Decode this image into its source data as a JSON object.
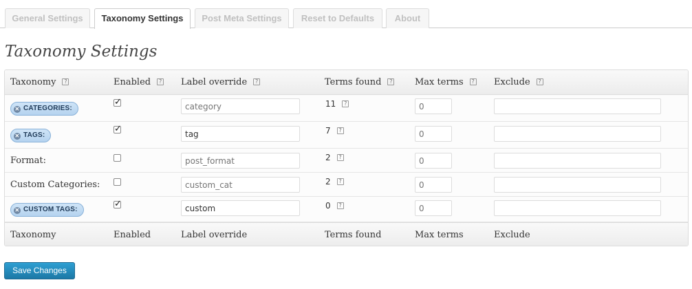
{
  "tabs": [
    {
      "label": "General Settings"
    },
    {
      "label": "Taxonomy Settings"
    },
    {
      "label": "Post Meta Settings"
    },
    {
      "label": "Reset to Defaults"
    },
    {
      "label": "About"
    }
  ],
  "active_tab": "Taxonomy Settings",
  "page_title": "Taxonomy Settings",
  "table": {
    "headers": {
      "taxonomy": "Taxonomy",
      "enabled": "Enabled",
      "label_override": "Label override",
      "terms_found": "Terms found",
      "max_terms": "Max terms",
      "exclude": "Exclude"
    },
    "help_glyph": "?",
    "rows": [
      {
        "taxonomy": "CATEGORIES:",
        "style": "pill",
        "enabled": true,
        "label_value": "",
        "label_placeholder": "category",
        "terms_found": "11",
        "max_terms_placeholder": "0",
        "exclude": ""
      },
      {
        "taxonomy": "TAGS:",
        "style": "pill",
        "enabled": true,
        "label_value": "tag",
        "label_placeholder": "",
        "terms_found": "7",
        "max_terms_placeholder": "0",
        "exclude": ""
      },
      {
        "taxonomy": "Format:",
        "style": "text",
        "enabled": false,
        "label_value": "",
        "label_placeholder": "post_format",
        "terms_found": "2",
        "max_terms_placeholder": "0",
        "exclude": ""
      },
      {
        "taxonomy": "Custom Categories:",
        "style": "text",
        "enabled": false,
        "label_value": "",
        "label_placeholder": "custom_cat",
        "terms_found": "2",
        "max_terms_placeholder": "0",
        "exclude": ""
      },
      {
        "taxonomy": "CUSTOM TAGS:",
        "style": "pill",
        "enabled": true,
        "label_value": "custom",
        "label_placeholder": "",
        "terms_found": "0",
        "max_terms_placeholder": "0",
        "exclude": ""
      }
    ]
  },
  "save_button": "Save Changes",
  "icons": {
    "help": "help-icon",
    "remove": "remove-x-icon",
    "check": "checkmark-icon"
  },
  "colors": {
    "button": "#2e9fd2",
    "pill": "#cfe4f7"
  }
}
